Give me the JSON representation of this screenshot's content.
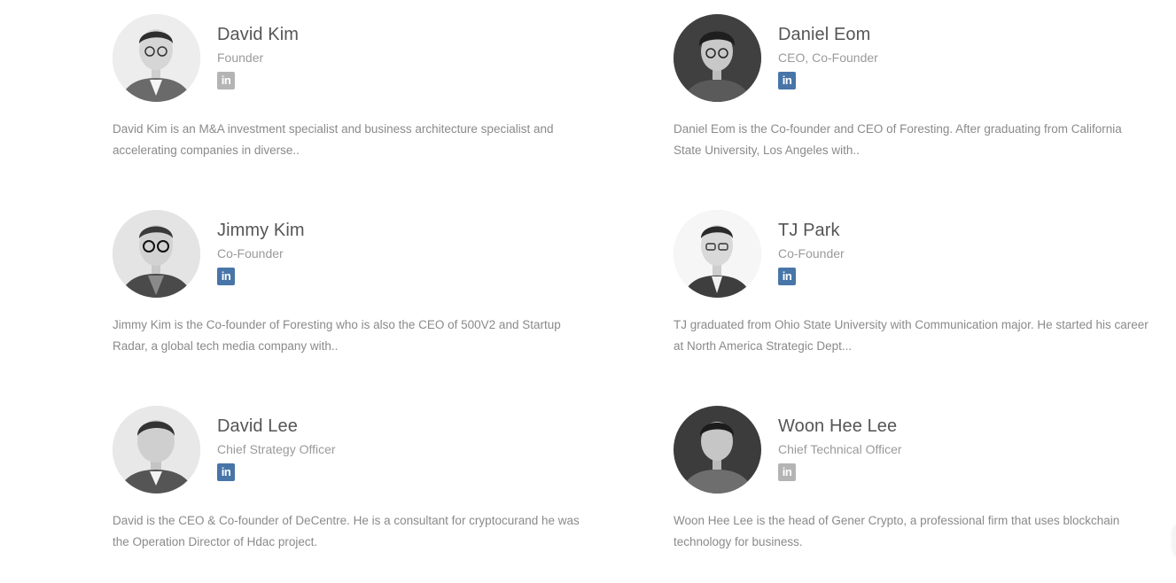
{
  "members": [
    {
      "name": "David Kim",
      "role": "Founder",
      "linkedin_state": "inactive",
      "bio": "David Kim is an M&A investment specialist and business architecture specialist and accelerating companies in diverse.."
    },
    {
      "name": "Daniel Eom",
      "role": "CEO, Co-Founder",
      "linkedin_state": "active",
      "bio": "Daniel Eom is the Co-founder and CEO of Foresting. After graduating from California State University, Los Angeles with.."
    },
    {
      "name": "Jimmy Kim",
      "role": "Co-Founder",
      "linkedin_state": "active",
      "bio": "Jimmy Kim is the Co-founder of Foresting who is also the CEO of 500V2 and Startup Radar, a global tech media company with.."
    },
    {
      "name": "TJ Park",
      "role": "Co-Founder",
      "linkedin_state": "active",
      "bio": "TJ graduated from Ohio State University with Communication major. He started his career at North America Strategic Dept..."
    },
    {
      "name": "David Lee",
      "role": "Chief Strategy Officer",
      "linkedin_state": "active",
      "bio": "David is the CEO & Co-founder of DeCentre. He is a consultant for cryptocurand he was the Operation Director of Hdac project."
    },
    {
      "name": "Woon Hee Lee",
      "role": "Chief Technical Officer",
      "linkedin_state": "inactive",
      "bio": "Woon Hee Lee is the head of Gener Crypto, a professional firm that uses blockchain technology for business."
    }
  ],
  "icons": {
    "linkedin_glyph": "in",
    "linkedin_active_color": "#4875a8",
    "linkedin_inactive_color": "#b4b4b4"
  }
}
